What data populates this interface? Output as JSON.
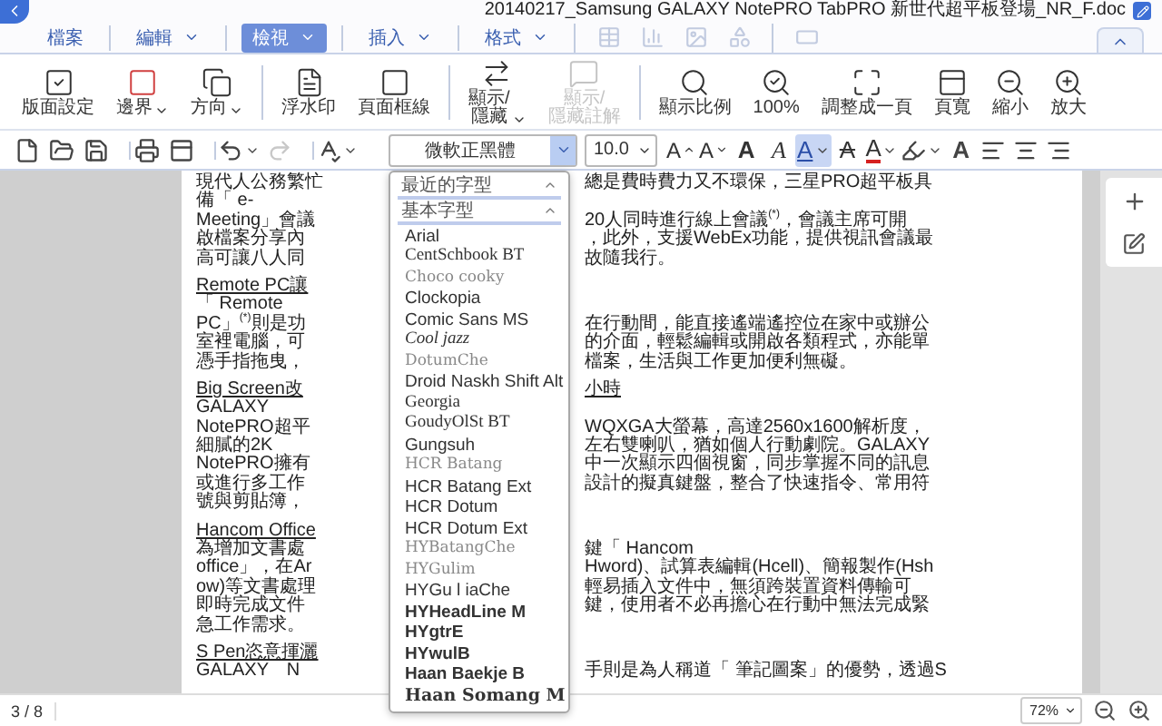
{
  "window": {
    "title": "20140217_Samsung GALAXY NotePRO  TabPRO 新世代超平板登場_NR_F.doc"
  },
  "menu_tabs": [
    {
      "label": "檔案",
      "has_menu": false,
      "selected": false
    },
    {
      "label": "編輯",
      "has_menu": true,
      "selected": false
    },
    {
      "label": "檢視",
      "has_menu": true,
      "selected": true
    },
    {
      "label": "插入",
      "has_menu": true,
      "selected": false
    },
    {
      "label": "格式",
      "has_menu": true,
      "selected": false
    }
  ],
  "tab_tools": [
    {
      "disabled": true,
      "group_start": true
    },
    {
      "disabled": true,
      "group_start": false
    },
    {
      "disabled": true,
      "group_start": false
    },
    {
      "disabled": true,
      "group_start": false
    },
    {
      "disabled": true,
      "group_start": true
    }
  ],
  "ribbon": [
    {
      "label": "版面設定",
      "has_menu": false,
      "disabled": false,
      "group_start": false
    },
    {
      "label": "邊界",
      "has_menu": true,
      "disabled": false,
      "group_start": false
    },
    {
      "label": "方向",
      "has_menu": true,
      "disabled": false,
      "group_start": false
    },
    {
      "label": "浮水印",
      "has_menu": false,
      "disabled": false,
      "group_start": true
    },
    {
      "label": "頁面框線",
      "has_menu": false,
      "disabled": false,
      "group_start": false
    },
    {
      "label": "顯示/\n隱藏",
      "has_menu": true,
      "disabled": false,
      "group_start": true
    },
    {
      "label": "顯示/\n隱藏註解",
      "has_menu": false,
      "disabled": true,
      "group_start": false
    },
    {
      "label": "顯示比例",
      "has_menu": false,
      "disabled": false,
      "group_start": true
    },
    {
      "label": "100%",
      "has_menu": false,
      "disabled": false,
      "group_start": false
    },
    {
      "label": "調整成一頁",
      "has_menu": false,
      "disabled": false,
      "group_start": false
    },
    {
      "label": "頁寬",
      "has_menu": false,
      "disabled": false,
      "group_start": false
    },
    {
      "label": "縮小",
      "has_menu": false,
      "disabled": false,
      "group_start": false
    },
    {
      "label": "放大",
      "has_menu": false,
      "disabled": false,
      "group_start": false
    }
  ],
  "format_toolbar": {
    "left_tools": [
      {
        "has_menu": false,
        "disabled": false,
        "group_start": false
      },
      {
        "has_menu": false,
        "disabled": false,
        "group_start": false
      },
      {
        "has_menu": false,
        "disabled": false,
        "group_start": false
      },
      {
        "has_menu": false,
        "disabled": false,
        "group_start": true
      },
      {
        "has_menu": false,
        "disabled": false,
        "group_start": false
      },
      {
        "has_menu": true,
        "disabled": false,
        "group_start": true
      },
      {
        "has_menu": false,
        "disabled": true,
        "group_start": false
      },
      {
        "has_menu": true,
        "disabled": false,
        "group_start": true
      }
    ],
    "font": {
      "value": "微軟正黑體"
    },
    "size": {
      "value": "10.0"
    },
    "text_tools": [
      {
        "kind": "grow",
        "glyph": "A",
        "has_menu": false,
        "selected": false
      },
      {
        "kind": "shrink",
        "glyph": "A",
        "has_menu": false,
        "selected": false
      },
      {
        "kind": "bold",
        "glyph": "A",
        "has_menu": false,
        "selected": false
      },
      {
        "kind": "italic",
        "glyph": "A",
        "has_menu": false,
        "selected": false
      },
      {
        "kind": "underline",
        "glyph": "A",
        "has_menu": true,
        "selected": true
      },
      {
        "kind": "strike",
        "glyph": "A",
        "has_menu": false,
        "selected": false
      },
      {
        "kind": "color",
        "glyph": "A",
        "has_menu": true,
        "selected": false
      },
      {
        "kind": "highlight",
        "has_menu": true,
        "selected": false
      },
      {
        "kind": "effect",
        "glyph": "A",
        "has_menu": false,
        "selected": false
      },
      {
        "kind": "align-left",
        "has_menu": false,
        "selected": false
      },
      {
        "kind": "align-center",
        "has_menu": false,
        "selected": false
      },
      {
        "kind": "align-right",
        "has_menu": false,
        "selected": false
      }
    ]
  },
  "font_menu": {
    "sections": [
      {
        "label": "最近的字型",
        "expanded": true
      },
      {
        "label": "基本字型",
        "expanded": true
      }
    ],
    "fonts": [
      {
        "name": "Arial",
        "kind": "sans"
      },
      {
        "name": "CentSchbook BT",
        "kind": "serif"
      },
      {
        "name": "Choco cooky",
        "kind": "light"
      },
      {
        "name": "Clockopia",
        "kind": "sans"
      },
      {
        "name": "Comic Sans MS",
        "kind": "sans"
      },
      {
        "name": "Cool jazz",
        "kind": "italic"
      },
      {
        "name": "DotumChe",
        "kind": "light"
      },
      {
        "name": "Droid Naskh Shift Alt",
        "kind": "sans"
      },
      {
        "name": "Georgia",
        "kind": "serif"
      },
      {
        "name": "GoudyOlSt BT",
        "kind": "serif"
      },
      {
        "name": "Gungsuh",
        "kind": "sans"
      },
      {
        "name": "HCR Batang",
        "kind": "light"
      },
      {
        "name": "HCR Batang Ext",
        "kind": "sans"
      },
      {
        "name": "HCR Dotum",
        "kind": "sans"
      },
      {
        "name": "HCR Dotum Ext",
        "kind": "sans"
      },
      {
        "name": "HYBatangChe",
        "kind": "light"
      },
      {
        "name": "HYGulim",
        "kind": "light"
      },
      {
        "name": "HYGu l iaChe",
        "kind": "sans"
      },
      {
        "name": "HYHeadLine M",
        "kind": "bold"
      },
      {
        "name": "HYgtrE",
        "kind": "bold"
      },
      {
        "name": "HYwulB",
        "kind": "bold"
      },
      {
        "name": "Haan Baekje B",
        "kind": "bold"
      },
      {
        "name": "Haan Somang M",
        "kind": "serifbold"
      }
    ]
  },
  "document": {
    "lines": [
      {
        "kind": "text",
        "left": "現代人公務繁忙",
        "right": "總是費時費力又不環保，三星PRO超平板具"
      },
      {
        "kind": "text",
        "left": "備「 e-"
      },
      {
        "kind": "text",
        "left": "Meeting」會議",
        "right": "20人同時進行線上會議$^{(*)}$，會議主席可開"
      },
      {
        "kind": "text",
        "left": "啟檔案分享內",
        "right": "，此外，支援WebEx功能，提供視訊會議最"
      },
      {
        "kind": "text",
        "left": "高可讓八人同",
        "right": "故隨我行。"
      },
      {
        "kind": "heading",
        "left": "Remote PC讓"
      },
      {
        "kind": "text",
        "left": "「 Remote"
      },
      {
        "kind": "text",
        "left": "PC」$^{(*)}$則是功",
        "right": "在行動間，能直接遙端遙控位在家中或辦公"
      },
      {
        "kind": "text",
        "left": "室裡電腦，可",
        "right": "的介面，輕鬆編輯或開啟各類程式，亦能單"
      },
      {
        "kind": "text",
        "left": "憑手指拖曳，",
        "right": "檔案，生活與工作更加便利無礙。"
      },
      {
        "kind": "heading",
        "left": "Big Screen改",
        "right": "小時"
      },
      {
        "kind": "text",
        "left": "GALAXY"
      },
      {
        "kind": "text",
        "left": "NotePRO超平",
        "right": "WQXGA大螢幕，高達2560x1600解析度，"
      },
      {
        "kind": "text",
        "left": "細膩的2K",
        "right": "左右雙喇叭，猶如個人行動劇院。GALAXY"
      },
      {
        "kind": "text",
        "left": "NotePRO擁有",
        "right": "中一次顯示四個視窗，同步掌握不同的訊息"
      },
      {
        "kind": "text",
        "left": "或進行多工作",
        "right": "設計的擬真鍵盤，整合了快速指令、常用符"
      },
      {
        "kind": "text",
        "left": "號與剪貼簿，"
      },
      {
        "kind": "heading",
        "left": "Hancom Office"
      },
      {
        "kind": "text",
        "left": "為增加文書處",
        "right": "鍵「 Hancom"
      },
      {
        "kind": "text",
        "left": "office」，在Ar",
        "right": "Hword)、試算表編輯(Hcell)、簡報製作(Hsh"
      },
      {
        "kind": "text",
        "left": "ow)等文書處理",
        "right": "輕易插入文件中，無須跨裝置資料傳輸可"
      },
      {
        "kind": "text",
        "left": "即時完成文件",
        "right": "鍵，使用者不必再擔心在行動中無法完成緊"
      },
      {
        "kind": "text",
        "left": "急工作需求。"
      },
      {
        "kind": "heading",
        "left": "S Pen恣意揮灑"
      },
      {
        "kind": "text",
        "left": "GALAXY　N",
        "right": "手則是為人稱道「 筆記圖案」的優勢，透過S"
      }
    ]
  },
  "status_bar": {
    "page": "3 / 8",
    "zoom": "72%"
  }
}
